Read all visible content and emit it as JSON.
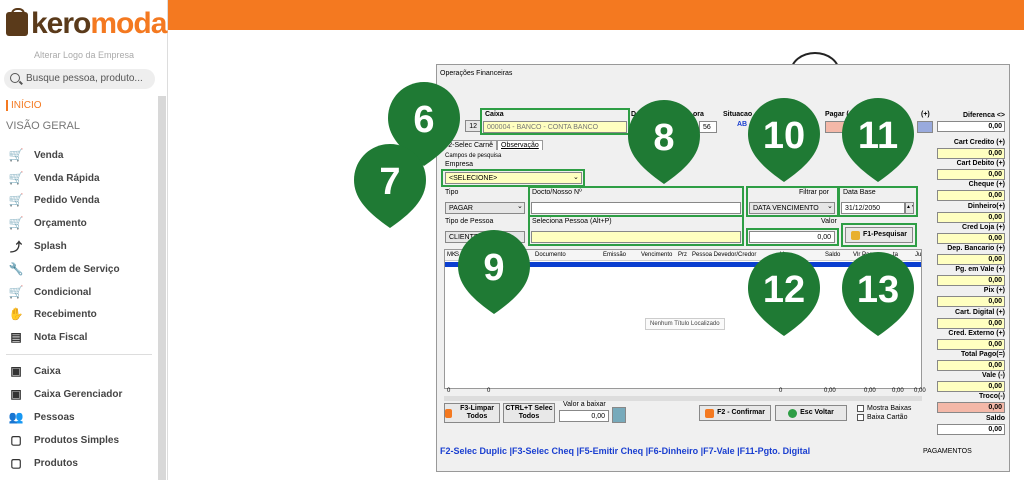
{
  "brand": {
    "name_left": "kero",
    "name_right": "moda",
    "alter_logo": "Alterar Logo da Empresa"
  },
  "search": {
    "placeholder": "Busque pessoa, produto..."
  },
  "nav": {
    "inicio": "INÍCIO",
    "visao_geral": "VISÃO GERAL"
  },
  "menu": [
    {
      "label": "Venda",
      "icon": "cart-icon"
    },
    {
      "label": "Venda Rápida",
      "icon": "cart-fast-icon"
    },
    {
      "label": "Pedido Venda",
      "icon": "cart-order-icon"
    },
    {
      "label": "Orçamento",
      "icon": "cart-quote-icon"
    },
    {
      "label": "Splash",
      "icon": "share-icon"
    },
    {
      "label": "Ordem de Serviço",
      "icon": "wrench-icon"
    },
    {
      "label": "Condicional",
      "icon": "cart-conditional-icon"
    },
    {
      "label": "Recebimento",
      "icon": "hand-money-icon"
    },
    {
      "label": "Nota Fiscal",
      "icon": "nfe-icon"
    },
    {
      "label": "Caixa",
      "icon": "cash-register-icon"
    },
    {
      "label": "Caixa Gerenciador",
      "icon": "cash-manager-icon"
    },
    {
      "label": "Pessoas",
      "icon": "people-icon"
    },
    {
      "label": "Produtos Simples",
      "icon": "box-icon"
    },
    {
      "label": "Produtos",
      "icon": "boxes-icon"
    }
  ],
  "window": {
    "title": "Operações Financeiras",
    "caixa_label": "Caixa",
    "caixa_num": "12",
    "caixa_value": "000004 - BANCO - CONTA BANCO",
    "d_label": "D",
    "hora_label": "ora",
    "hora_value": "56",
    "situacao_label": "Situacao",
    "situacao_value": "AB",
    "pagar_label": "Pagar (",
    "pagar_plus": "(+)",
    "tab_carne": "F2-Selec Carnê",
    "tab_obs": "Observação",
    "campos_pesquisa": "Campos de pesquisa",
    "empresa_label": "Empresa",
    "empresa_value": "<SELECIONE>",
    "tipo_label": "Tipo",
    "tipo_value": "PAGAR",
    "docto_label": "Docto/Nosso Nº",
    "filtrar_label": "Filtrar por",
    "filtrar_value": "DATA VENCIMENTO",
    "data_base_label": "Data Base",
    "data_base_value": "31/12/2050",
    "tipo_pessoa_label": "Tipo de Pessoa",
    "tipo_pessoa_value": "CLIENTE",
    "seleciona_label": "Seleciona Pessoa (Alt+P)",
    "valor_label": "Valor",
    "valor_value": "0,00",
    "pesquisar_btn": "F1-Pesquisar",
    "grid_cols": [
      "MK",
      "S",
      "Documento",
      "Emissão",
      "Vencimento",
      "Prz",
      "Pessoa Devedor/Credor",
      "V",
      "Saldo",
      "Vlr Pag",
      "ta",
      "Ju"
    ],
    "grid_empty": "Nenhum Título Localizado",
    "grid_foot": [
      "0",
      "0",
      "0",
      "0,00",
      "0,00",
      "0,00",
      "0,00"
    ],
    "limpar_btn": "F3-Limpar Todos",
    "selec_todos_btn": "CTRL+T Selec Todos",
    "valor_baixar_label": "Valor a baixar",
    "valor_baixar_value": "0,00",
    "confirmar_btn": "F2 - Confirmar",
    "voltar_btn": "Esc Voltar",
    "mostra_baixas": "Mostra Baixas",
    "baixa_cartao": "Baixa Cartão",
    "shortcuts": "F2-Selec Duplic |F3-Selec Cheq |F5-Emitir Cheq |F6-Dinheiro |F7-Vale |F11-Pgto. Digital",
    "pagamentos": "PAGAMENTOS",
    "diferenca_label": "Diferenca <>",
    "diferenca_value": "0,00"
  },
  "right_panel": [
    {
      "label": "Cart Credito (+)",
      "value": "0,00",
      "color": "#ffffc0"
    },
    {
      "label": "Cart Debito (+)",
      "value": "0,00",
      "color": "#ffffc0"
    },
    {
      "label": "Cheque (+)",
      "value": "0,00",
      "color": "#ffffc0"
    },
    {
      "label": "Dinheiro(+)",
      "value": "0,00",
      "color": "#ffffc0"
    },
    {
      "label": "Cred Loja (+)",
      "value": "0,00",
      "color": "#ffffc0"
    },
    {
      "label": "Dep. Bancario (+)",
      "value": "0,00",
      "color": "#ffffc0"
    },
    {
      "label": "Pg. em Vale (+)",
      "value": "0,00",
      "color": "#ffffc0"
    },
    {
      "label": "Pix (+)",
      "value": "0,00",
      "color": "#ffffc0"
    },
    {
      "label": "Cart. Digital (+)",
      "value": "0,00",
      "color": "#ffffc0"
    },
    {
      "label": "Cred. Externo (+)",
      "value": "0,00",
      "color": "#ffffc0"
    },
    {
      "label": "Total Pago(=)",
      "value": "0,00",
      "color": "#ffffc0"
    },
    {
      "label": "Vale (-)",
      "value": "0,00",
      "color": "#ffffc0"
    },
    {
      "label": "Troco(-)",
      "value": "0,00",
      "color": "#f4b8a8"
    },
    {
      "label": "Saldo",
      "value": "0,00",
      "color": "#ffffff"
    }
  ],
  "badges": [
    "6",
    "7",
    "8",
    "9",
    "10",
    "11",
    "12",
    "13"
  ],
  "colors": {
    "accent": "#f47920",
    "badge": "#1f7a34",
    "highlight": "#2e9e45"
  }
}
